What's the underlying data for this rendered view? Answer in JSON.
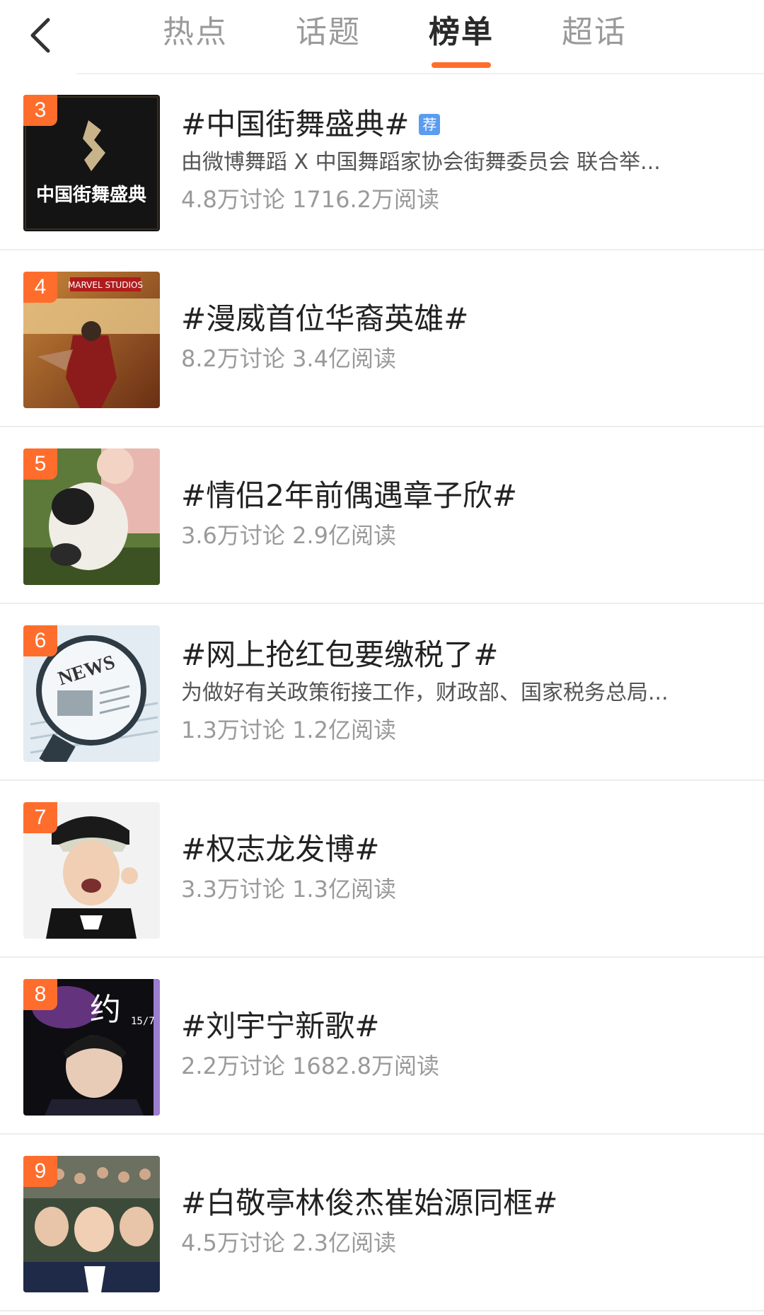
{
  "header": {
    "back_icon": "chevron-left-icon",
    "tabs": [
      {
        "label": "热点",
        "active": false
      },
      {
        "label": "话题",
        "active": false
      },
      {
        "label": "榜单",
        "active": true
      },
      {
        "label": "超话",
        "active": false
      }
    ]
  },
  "colors": {
    "accent": "#ff6d2d",
    "recommend_tag": "#5b9cf0"
  },
  "topics": [
    {
      "rank": "3",
      "title": "#中国街舞盛典#",
      "tag": "荐",
      "thumb_text": "中国街舞盛典",
      "description": "由微博舞蹈 X 中国舞蹈家协会街舞委员会 联合举...",
      "stats": "4.8万讨论 1716.2万阅读"
    },
    {
      "rank": "4",
      "title": "#漫威首位华裔英雄#",
      "thumb_text": "MARVEL STUDIOS",
      "stats": "8.2万讨论 3.4亿阅读"
    },
    {
      "rank": "5",
      "title": "#情侣2年前偶遇章子欣#",
      "stats": "3.6万讨论 2.9亿阅读"
    },
    {
      "rank": "6",
      "title": "#网上抢红包要缴税了#",
      "thumb_text": "NEWS",
      "description": "为做好有关政策衔接工作，财政部、国家税务总局...",
      "stats": "1.3万讨论 1.2亿阅读"
    },
    {
      "rank": "7",
      "title": "#权志龙发博#",
      "stats": "3.3万讨论 1.3亿阅读"
    },
    {
      "rank": "8",
      "title": "#刘宇宁新歌#",
      "thumb_text": "15/7",
      "stats": "2.2万讨论 1682.8万阅读"
    },
    {
      "rank": "9",
      "title": "#白敬亭林俊杰崔始源同框#",
      "stats": "4.5万讨论 2.3亿阅读"
    }
  ]
}
